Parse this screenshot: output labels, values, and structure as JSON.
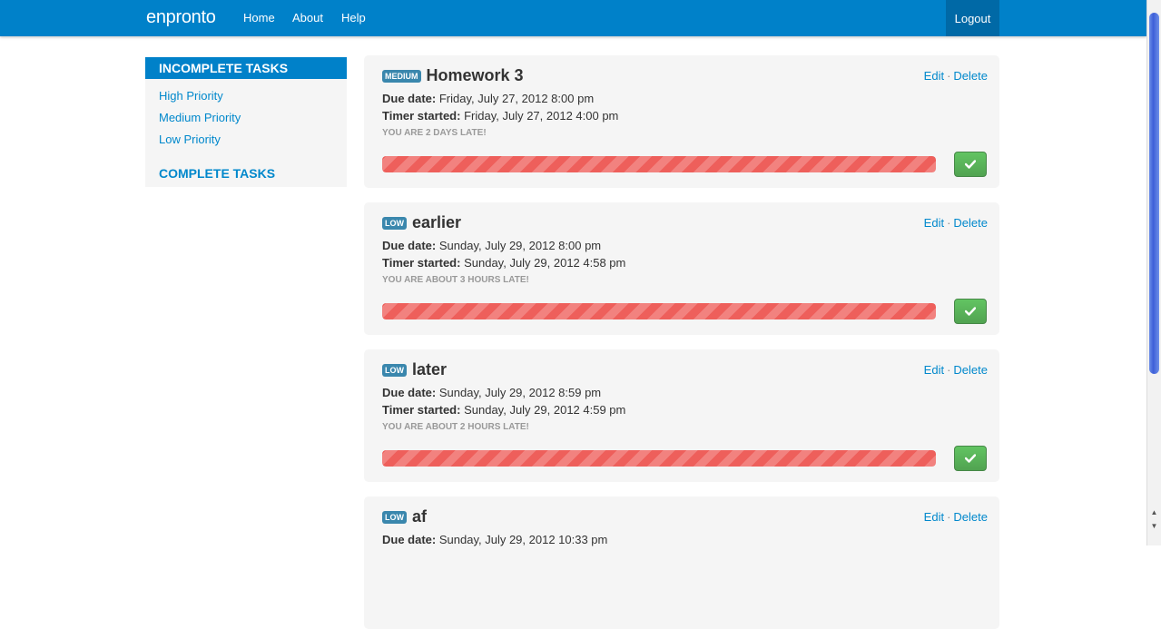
{
  "navbar": {
    "brand": "enpronto",
    "links": [
      "Home",
      "About",
      "Help"
    ],
    "logout": "Logout"
  },
  "sidebar": {
    "header": "INCOMPLETE TASKS",
    "items": [
      "High Priority",
      "Medium Priority",
      "Low Priority"
    ],
    "complete": "COMPLETE TASKS"
  },
  "tasks": [
    {
      "priority": "MEDIUM",
      "title": "Homework 3",
      "due_label": "Due date:",
      "due": "Friday, July 27, 2012 8:00 pm",
      "timer_label": "Timer started:",
      "timer": "Friday, July 27, 2012 4:00 pm",
      "late": "YOU ARE 2 DAYS LATE!",
      "progress": 1.0
    },
    {
      "priority": "LOW",
      "title": "earlier",
      "due_label": "Due date:",
      "due": "Sunday, July 29, 2012 8:00 pm",
      "timer_label": "Timer started:",
      "timer": "Sunday, July 29, 2012 4:58 pm",
      "late": "YOU ARE ABOUT 3 HOURS LATE!",
      "progress": 1.0
    },
    {
      "priority": "LOW",
      "title": "later",
      "due_label": "Due date:",
      "due": "Sunday, July 29, 2012 8:59 pm",
      "timer_label": "Timer started:",
      "timer": "Sunday, July 29, 2012 4:59 pm",
      "late": "YOU ARE ABOUT 2 HOURS LATE!",
      "progress": 1.0
    },
    {
      "priority": "LOW",
      "title": "af",
      "due_label": "Due date:",
      "due": "Sunday, July 29, 2012 10:33 pm"
    }
  ],
  "actions": {
    "edit": "Edit",
    "separator": "·",
    "delete": "Delete"
  },
  "colors": {
    "navbar": "#0081c9",
    "link": "#0088cc",
    "badge": "#3a87ad",
    "danger_bar": "#ee5f5b",
    "success_button": "#5bb75b"
  },
  "icons": {
    "done": "check-icon"
  }
}
